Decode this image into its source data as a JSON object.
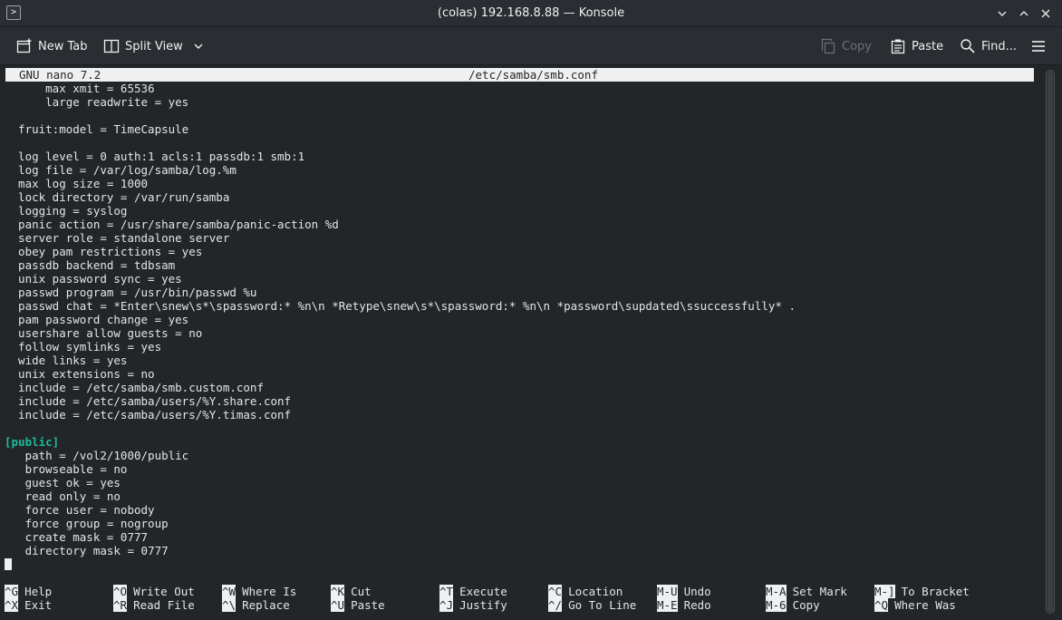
{
  "window": {
    "title": "(colas) 192.168.8.88 — Konsole",
    "app_icon_glyph": ">"
  },
  "toolbar": {
    "new_tab": "New Tab",
    "split_view": "Split View",
    "copy": "Copy",
    "paste": "Paste",
    "find": "Find..."
  },
  "nano": {
    "version": "GNU nano 7.2",
    "filename": "/etc/samba/smb.conf"
  },
  "editor_lines": [
    "      max xmit = 65536",
    "      large readwrite = yes",
    "",
    "  fruit:model = TimeCapsule",
    "",
    "  log level = 0 auth:1 acls:1 passdb:1 smb:1",
    "  log file = /var/log/samba/log.%m",
    "  max log size = 1000",
    "  lock directory = /var/run/samba",
    "  logging = syslog",
    "  panic action = /usr/share/samba/panic-action %d",
    "  server role = standalone server",
    "  obey pam restrictions = yes",
    "  passdb backend = tdbsam",
    "  unix password sync = yes",
    "  passwd program = /usr/bin/passwd %u",
    "  passwd chat = *Enter\\snew\\s*\\spassword:* %n\\n *Retype\\snew\\s*\\spassword:* %n\\n *password\\supdated\\ssuccessfully* .",
    "  pam password change = yes",
    "  usershare allow guests = no",
    "  follow symlinks = yes",
    "  wide links = yes",
    "  unix extensions = no",
    "  include = /etc/samba/smb.custom.conf",
    "  include = /etc/samba/users/%Y.share.conf",
    "  include = /etc/samba/users/%Y.timas.conf",
    "",
    "[public]",
    "   path = /vol2/1000/public",
    "   browseable = no",
    "   guest ok = yes",
    "   read only = no",
    "   force user = nobody",
    "   force group = nogroup",
    "   create mask = 0777",
    "   directory mask = 0777"
  ],
  "shortcuts_row1": [
    {
      "key": "^G",
      "label": "Help"
    },
    {
      "key": "^O",
      "label": "Write Out"
    },
    {
      "key": "^W",
      "label": "Where Is"
    },
    {
      "key": "^K",
      "label": "Cut"
    },
    {
      "key": "^T",
      "label": "Execute"
    },
    {
      "key": "^C",
      "label": "Location"
    },
    {
      "key": "M-U",
      "label": "Undo"
    },
    {
      "key": "M-A",
      "label": "Set Mark"
    },
    {
      "key": "M-]",
      "label": "To Bracket"
    }
  ],
  "shortcuts_row2": [
    {
      "key": "^X",
      "label": "Exit"
    },
    {
      "key": "^R",
      "label": "Read File"
    },
    {
      "key": "^\\",
      "label": "Replace"
    },
    {
      "key": "^U",
      "label": "Paste"
    },
    {
      "key": "^J",
      "label": "Justify"
    },
    {
      "key": "^/",
      "label": "Go To Line"
    },
    {
      "key": "M-E",
      "label": "Redo"
    },
    {
      "key": "M-6",
      "label": "Copy"
    },
    {
      "key": "^Q",
      "label": "Where Was"
    }
  ],
  "colors": {
    "background": "#232629",
    "section_header": "#1abc9c",
    "text": "#e3e5e7"
  }
}
